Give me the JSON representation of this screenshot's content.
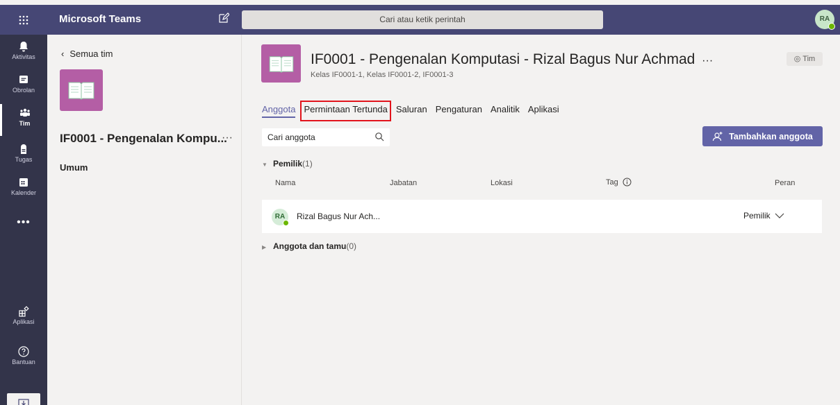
{
  "app": {
    "title": "Microsoft Teams"
  },
  "search": {
    "placeholder": "Cari atau ketik perintah"
  },
  "user": {
    "initials": "RA"
  },
  "rail": {
    "items": [
      {
        "label": "Aktivitas",
        "icon": "bell-icon"
      },
      {
        "label": "Obrolan",
        "icon": "chat-icon"
      },
      {
        "label": "Tim",
        "icon": "teams-icon"
      },
      {
        "label": "Tugas",
        "icon": "assignments-icon"
      },
      {
        "label": "Kalender",
        "icon": "calendar-icon"
      }
    ],
    "more": "•••",
    "apps_label": "Aplikasi",
    "help_label": "Bantuan"
  },
  "left": {
    "back_label": "Semua tim",
    "team_name": "IF0001 - Pengenalan Kompu...",
    "more": "···",
    "channel": "Umum"
  },
  "header": {
    "title": "IF0001 - Pengenalan Komputasi - Rizal Bagus Nur Achmad",
    "more": "···",
    "subtitle": "Kelas IF0001-1, Kelas IF0001-2, IF0001-3",
    "tim_badge": "Tim"
  },
  "tabs": [
    "Anggota",
    "Permintaan Tertunda",
    "Saluran",
    "Pengaturan",
    "Analitik",
    "Aplikasi"
  ],
  "members": {
    "search_placeholder": "Cari anggota",
    "add_button": "Tambahkan anggota",
    "owners": {
      "label": "Pemilik",
      "count": "(1)"
    },
    "columns": {
      "name": "Nama",
      "title": "Jabatan",
      "location": "Lokasi",
      "tag": "Tag",
      "role": "Peran"
    },
    "rows": [
      {
        "initials": "RA",
        "name": "Rizal Bagus Nur Ach...",
        "role": "Pemilik"
      }
    ],
    "guests": {
      "label": "Anggota dan tamu",
      "count": "(0)"
    }
  },
  "colors": {
    "brand": "#464775",
    "rail": "#33344a",
    "accent": "#6264a7",
    "highlight": "#e2141c",
    "team_tile": "#b45ea5"
  }
}
